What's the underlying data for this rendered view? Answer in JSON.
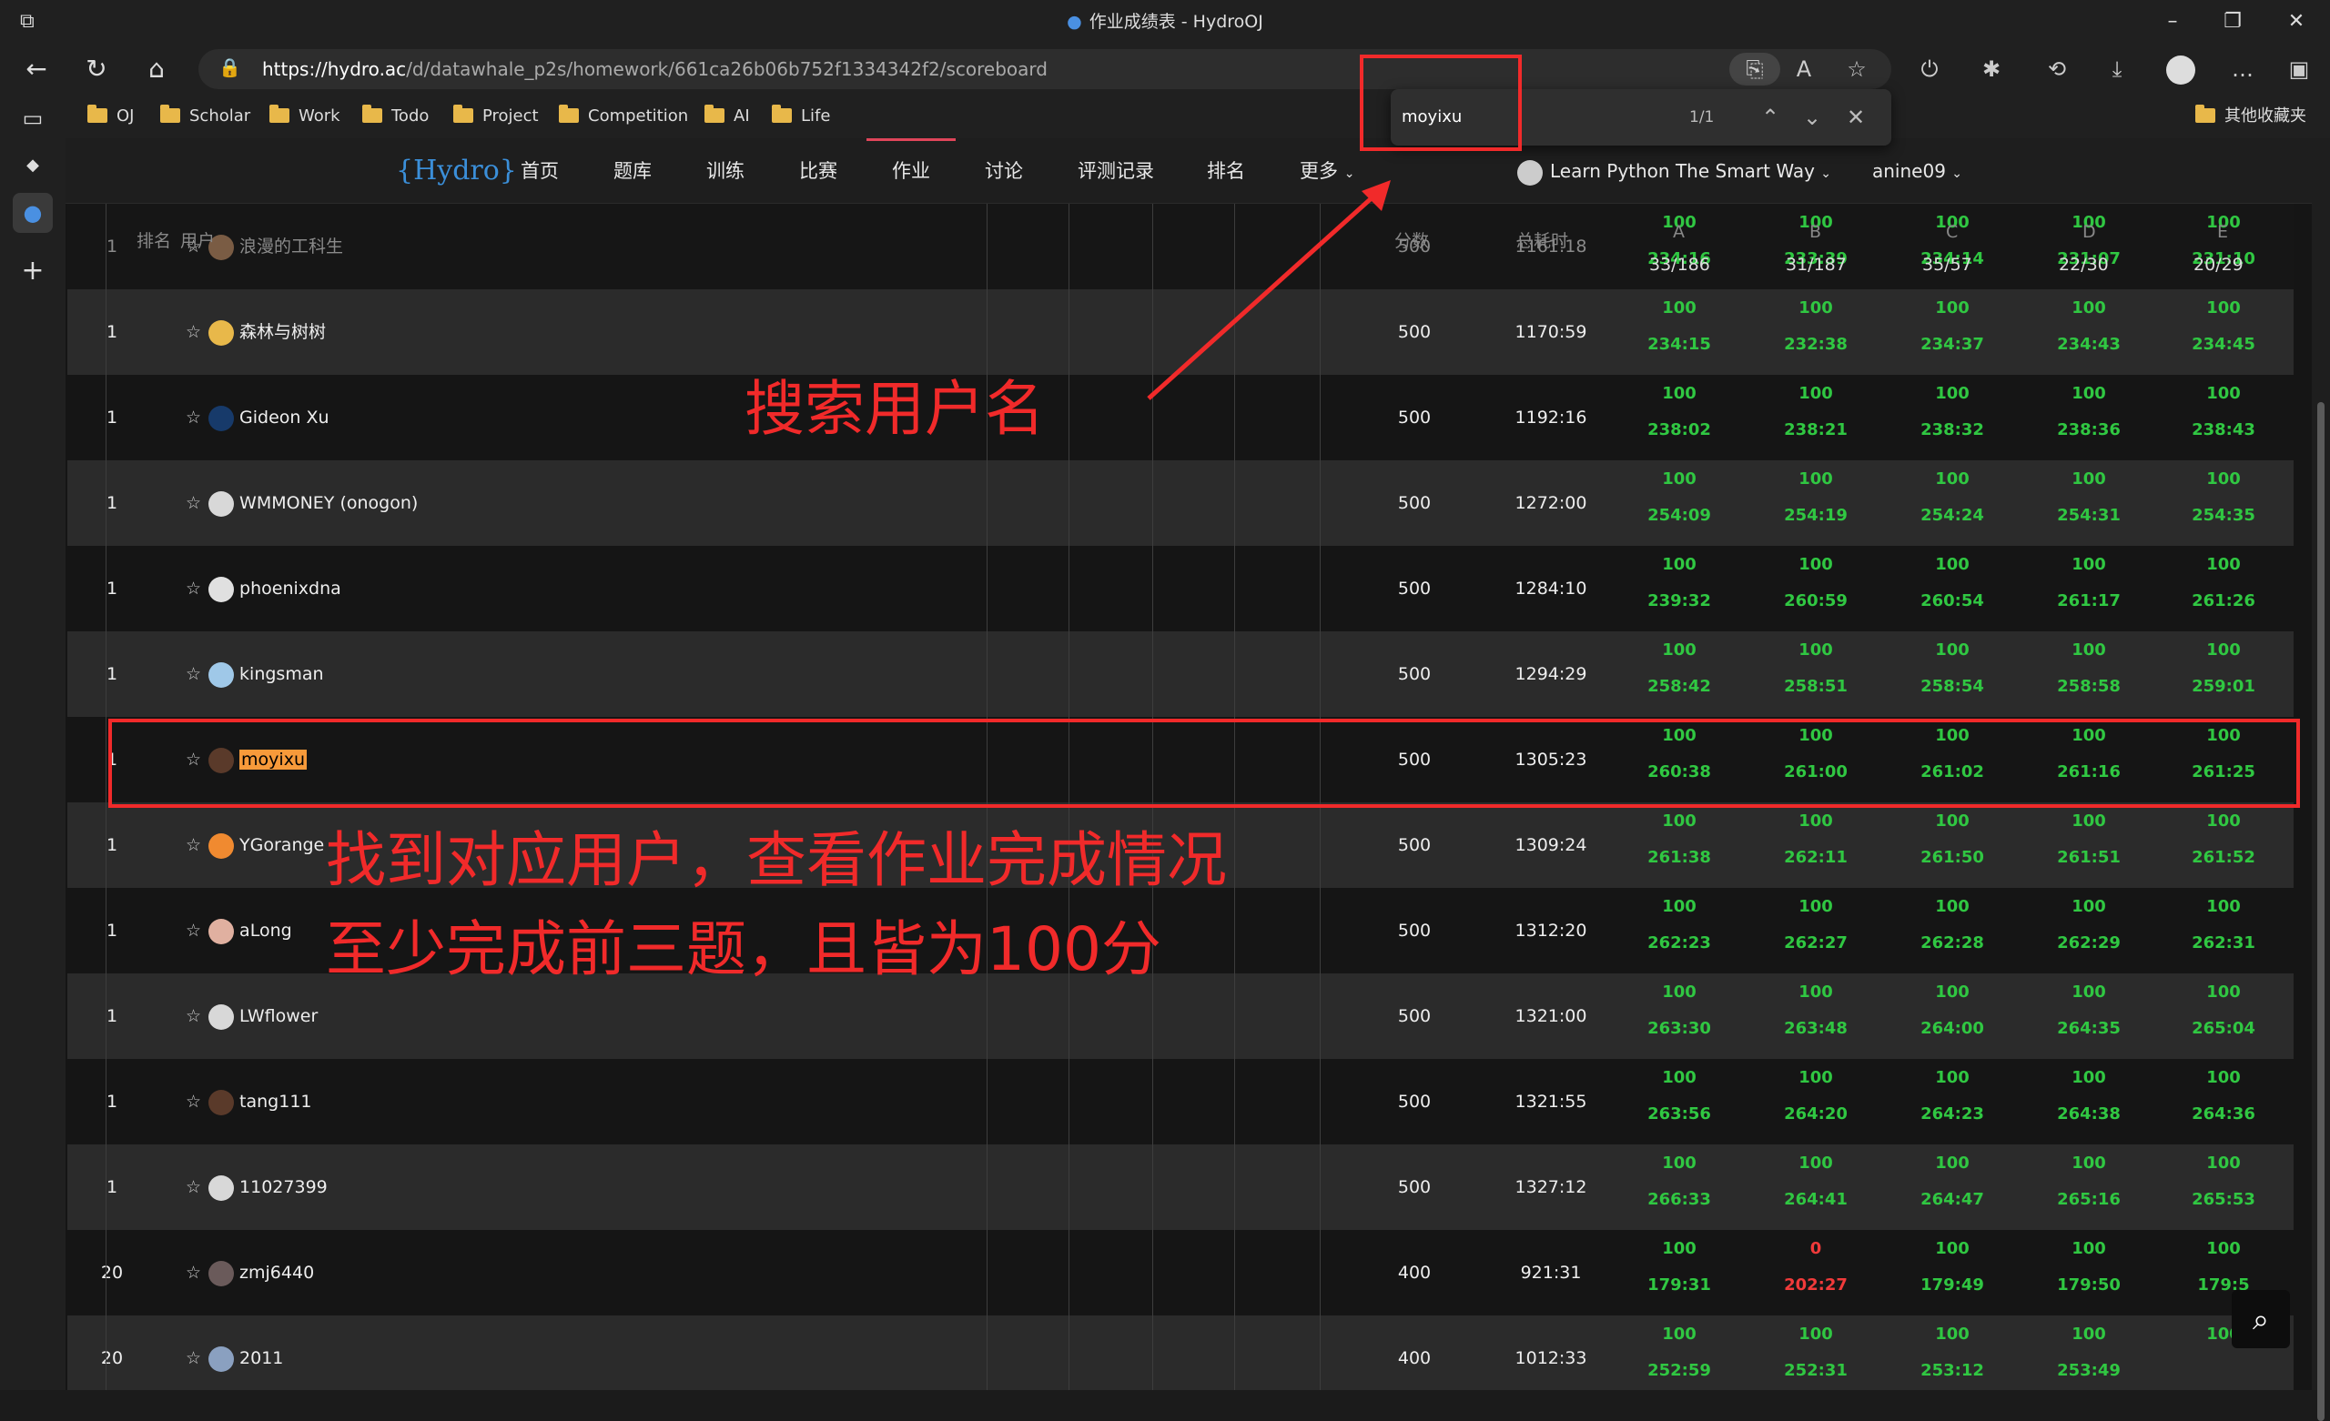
{
  "browser": {
    "window_title": "作业成绩表 - HydroOJ",
    "url_host": "https://hydro.ac",
    "url_path": "/d/datawhale_p2s/homework/661ca26b06b752f1334342f2/scoreboard",
    "bookmarks": [
      "OJ",
      "Scholar",
      "Work",
      "Todo",
      "Project",
      "Competition",
      "AI",
      "Life"
    ],
    "other_bookmarks": "其他收藏夹"
  },
  "find": {
    "query": "moyixu",
    "count": "1/1"
  },
  "nav": {
    "logo": "{Hydro}",
    "items": [
      "首页",
      "题库",
      "训练",
      "比赛",
      "作业",
      "讨论",
      "评测记录",
      "排名",
      "更多"
    ],
    "active_index": 4,
    "course": "Learn Python The Smart Way",
    "user": "anine09"
  },
  "header": {
    "rank": "排名",
    "user": "用户",
    "score": "分数",
    "time": "总耗时",
    "problems": [
      "A",
      "B",
      "C",
      "D",
      "E"
    ],
    "stats": [
      "33/186",
      "31/187",
      "35/57",
      "22/30",
      "20/29"
    ]
  },
  "sticky_row": {
    "rank": "1",
    "name": "浪漫的工科生",
    "score": "500",
    "time": "1161:18",
    "scores": [
      "100",
      "100",
      "100",
      "100",
      "100"
    ],
    "times": [
      "234:16",
      "233:39",
      "234:14",
      "231:07",
      "231:10"
    ]
  },
  "rows": [
    {
      "rank": "1",
      "name": "森林与树树",
      "score": "500",
      "time": "1170:59",
      "scores": [
        "100",
        "100",
        "100",
        "100",
        "100"
      ],
      "times": [
        "234:15",
        "232:38",
        "234:37",
        "234:43",
        "234:45"
      ]
    },
    {
      "rank": "1",
      "name": "Gideon Xu",
      "score": "500",
      "time": "1192:16",
      "scores": [
        "100",
        "100",
        "100",
        "100",
        "100"
      ],
      "times": [
        "238:02",
        "238:21",
        "238:32",
        "238:36",
        "238:43"
      ]
    },
    {
      "rank": "1",
      "name": "WMMONEY (onogon)",
      "score": "500",
      "time": "1272:00",
      "scores": [
        "100",
        "100",
        "100",
        "100",
        "100"
      ],
      "times": [
        "254:09",
        "254:19",
        "254:24",
        "254:31",
        "254:35"
      ]
    },
    {
      "rank": "1",
      "name": "phoenixdna",
      "score": "500",
      "time": "1284:10",
      "scores": [
        "100",
        "100",
        "100",
        "100",
        "100"
      ],
      "times": [
        "239:32",
        "260:59",
        "260:54",
        "261:17",
        "261:26"
      ]
    },
    {
      "rank": "1",
      "name": "kingsman",
      "score": "500",
      "time": "1294:29",
      "scores": [
        "100",
        "100",
        "100",
        "100",
        "100"
      ],
      "times": [
        "258:42",
        "258:51",
        "258:54",
        "258:58",
        "259:01"
      ]
    },
    {
      "rank": "1",
      "name": "moyixu",
      "score": "500",
      "time": "1305:23",
      "scores": [
        "100",
        "100",
        "100",
        "100",
        "100"
      ],
      "times": [
        "260:38",
        "261:00",
        "261:02",
        "261:16",
        "261:25"
      ]
    },
    {
      "rank": "1",
      "name": "YGorange",
      "score": "500",
      "time": "1309:24",
      "scores": [
        "100",
        "100",
        "100",
        "100",
        "100"
      ],
      "times": [
        "261:38",
        "262:11",
        "261:50",
        "261:51",
        "261:52"
      ]
    },
    {
      "rank": "1",
      "name": "aLong",
      "score": "500",
      "time": "1312:20",
      "scores": [
        "100",
        "100",
        "100",
        "100",
        "100"
      ],
      "times": [
        "262:23",
        "262:27",
        "262:28",
        "262:29",
        "262:31"
      ]
    },
    {
      "rank": "1",
      "name": "LWflower",
      "score": "500",
      "time": "1321:00",
      "scores": [
        "100",
        "100",
        "100",
        "100",
        "100"
      ],
      "times": [
        "263:30",
        "263:48",
        "264:00",
        "264:35",
        "265:04"
      ]
    },
    {
      "rank": "1",
      "name": "tang111",
      "score": "500",
      "time": "1321:55",
      "scores": [
        "100",
        "100",
        "100",
        "100",
        "100"
      ],
      "times": [
        "263:56",
        "264:20",
        "264:23",
        "264:38",
        "264:36"
      ]
    },
    {
      "rank": "1",
      "name": "11027399",
      "score": "500",
      "time": "1327:12",
      "scores": [
        "100",
        "100",
        "100",
        "100",
        "100"
      ],
      "times": [
        "266:33",
        "264:41",
        "264:47",
        "265:16",
        "265:53"
      ]
    },
    {
      "rank": "20",
      "name": "zmj6440",
      "score": "400",
      "time": "921:31",
      "scores": [
        "100",
        "0",
        "100",
        "100",
        "100"
      ],
      "times": [
        "179:31",
        "202:27",
        "179:49",
        "179:50",
        "179:5"
      ]
    },
    {
      "rank": "20",
      "name": "2011",
      "score": "400",
      "time": "1012:33",
      "scores": [
        "100",
        "100",
        "100",
        "100",
        "100"
      ],
      "times": [
        "252:59",
        "252:31",
        "253:12",
        "253:49",
        ""
      ]
    }
  ],
  "annotations": {
    "search_label": "搜索用户名",
    "found_line1": "找到对应用户，查看作业完成情况",
    "found_line2": "至少完成前三题，且皆为100分"
  },
  "colors": {
    "accent": "#e0455a",
    "pass": "#30c742",
    "fail": "#f03a3a",
    "annotation": "#f12a2a",
    "highlight": "#f79a3a"
  }
}
